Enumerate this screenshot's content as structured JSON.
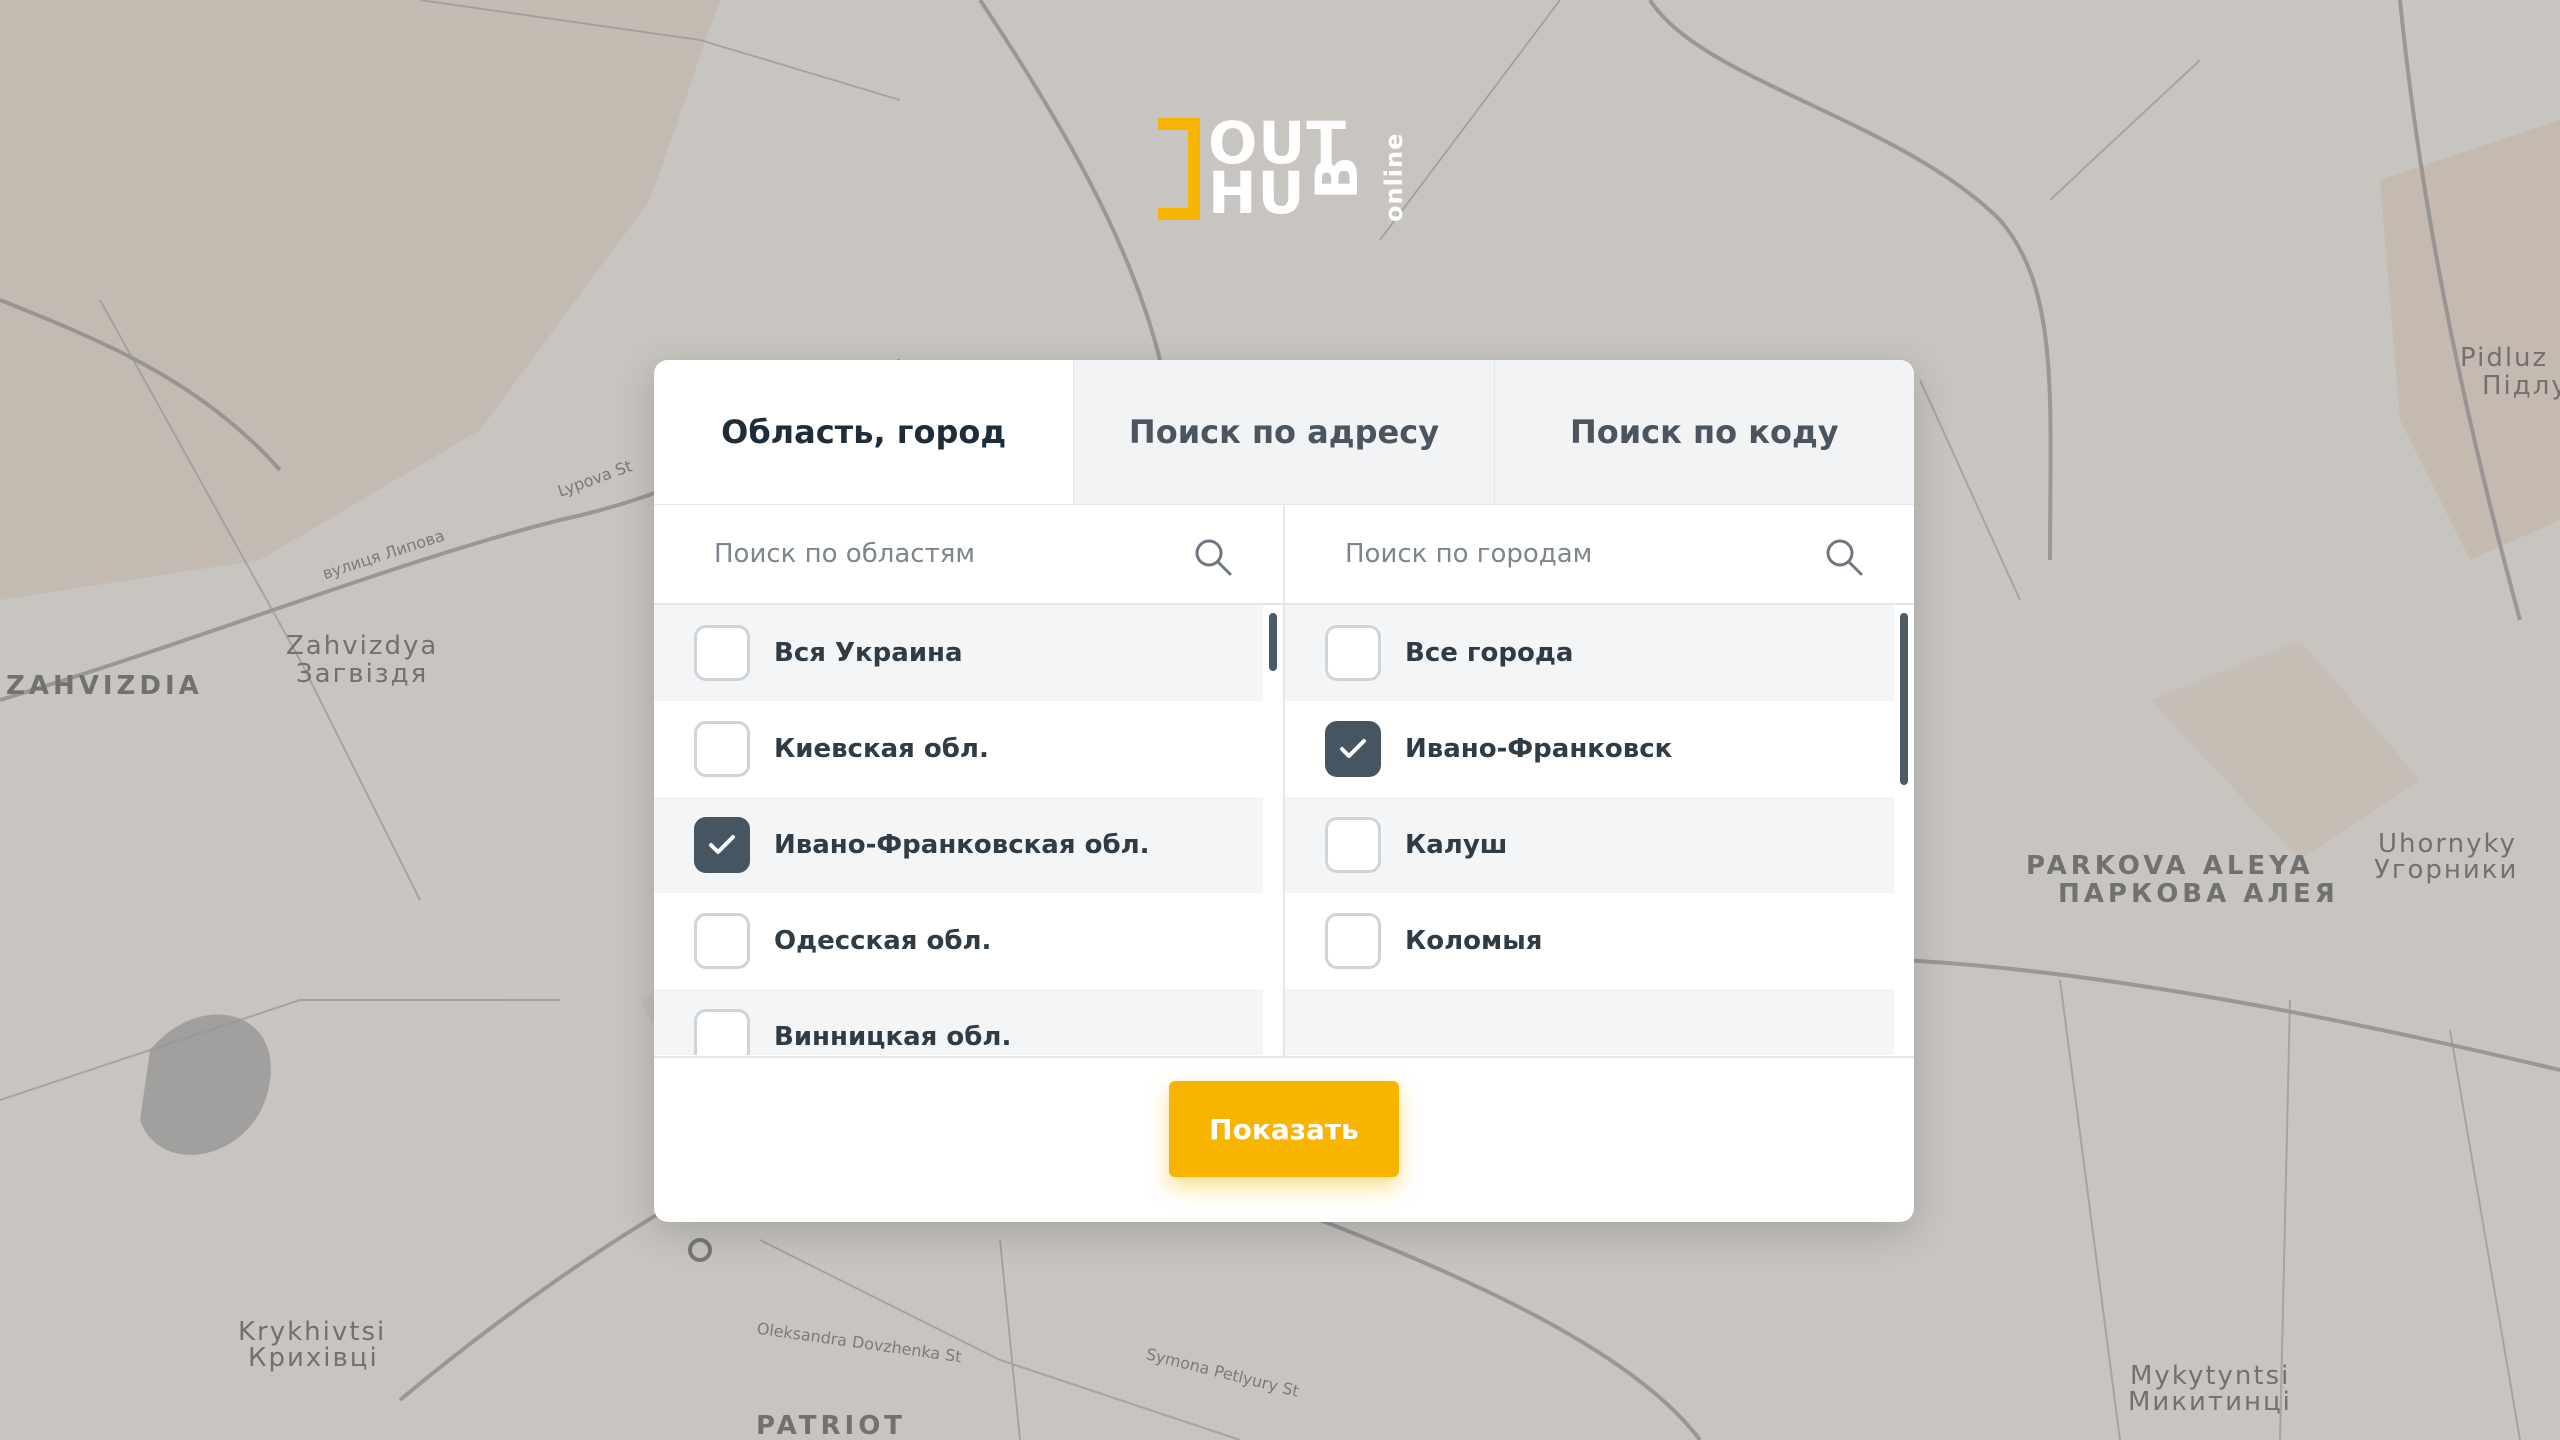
{
  "logo": {
    "line1": "OUT",
    "line2": "HU",
    "rotated_letter": "B",
    "suffix": "online",
    "accent_color": "#f6b400"
  },
  "map": {
    "labels": [
      {
        "text": "ZAHVIZDIA",
        "style": "big"
      },
      {
        "text": "Zahvizdya",
        "style": "mid"
      },
      {
        "text": "Загвіздя",
        "style": "mid"
      },
      {
        "text": "PARKOVA ALEYA",
        "style": "big"
      },
      {
        "text": "ПАРКОВА АЛЕЯ",
        "style": "big"
      },
      {
        "text": "Uhornyky",
        "style": "mid"
      },
      {
        "text": "Угорники",
        "style": "mid"
      },
      {
        "text": "Pidluz",
        "style": "mid"
      },
      {
        "text": "Підлу",
        "style": "mid"
      },
      {
        "text": "Krykhivtsi",
        "style": "mid"
      },
      {
        "text": "Крихівці",
        "style": "mid"
      },
      {
        "text": "Mykytyntsi",
        "style": "mid"
      },
      {
        "text": "Микитинці",
        "style": "mid"
      },
      {
        "text": "PATRIOT",
        "style": "big"
      },
      {
        "text": "Lypova St",
        "style": "small"
      },
      {
        "text": "вулиця Липова",
        "style": "small"
      },
      {
        "text": "Symona Petlyury St",
        "style": "small"
      },
      {
        "text": "Oleksandra Dovzhenka St",
        "style": "small"
      }
    ]
  },
  "tabs": [
    {
      "label": "Область, город",
      "active": true
    },
    {
      "label": "Поиск по адресу",
      "active": false
    },
    {
      "label": "Поиск по коду",
      "active": false
    }
  ],
  "regions": {
    "search_placeholder": "Поиск по областям",
    "items": [
      {
        "label": "Вся Украина",
        "checked": false
      },
      {
        "label": "Киевская обл.",
        "checked": false
      },
      {
        "label": "Ивано-Франковская обл.",
        "checked": true
      },
      {
        "label": "Одесская обл.",
        "checked": false
      },
      {
        "label": "Винницкая обл.",
        "checked": false
      }
    ]
  },
  "cities": {
    "search_placeholder": "Поиск по городам",
    "items": [
      {
        "label": "Все города",
        "checked": false
      },
      {
        "label": "Ивано-Франковск",
        "checked": true
      },
      {
        "label": "Калуш",
        "checked": false
      },
      {
        "label": "Коломыя",
        "checked": false
      }
    ]
  },
  "show_button": {
    "label": "Показать",
    "color": "#f7b500"
  }
}
